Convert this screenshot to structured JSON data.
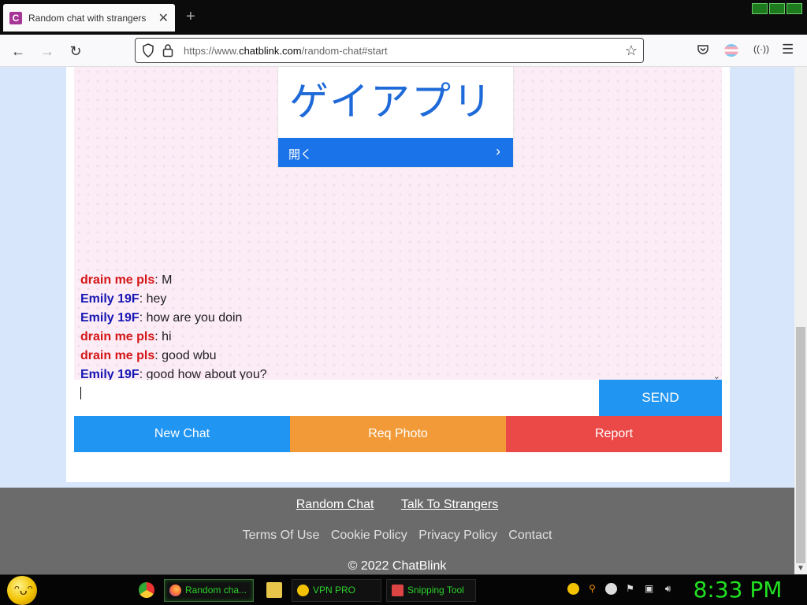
{
  "browser": {
    "tab_title": "Random chat with strangers",
    "favicon_letter": "C",
    "url_prefix": "https://www.",
    "url_host": "chatblink.com",
    "url_path": "/random-chat#start"
  },
  "ad": {
    "title": "ゲイアプリ",
    "open_label": "開く"
  },
  "chat": {
    "messages": [
      {
        "sender": "drain me pls",
        "text": ": M",
        "color": "#d41616"
      },
      {
        "sender": "Emily 19F",
        "text": ": hey",
        "color": "#1717b3"
      },
      {
        "sender": "Emily 19F",
        "text": ": how are you doin",
        "color": "#1717b3"
      },
      {
        "sender": "drain me pls",
        "text": ": hi",
        "color": "#d41616"
      },
      {
        "sender": "drain me pls",
        "text": ": good wbu",
        "color": "#d41616"
      },
      {
        "sender": "Emily 19F",
        "text": ": good how about you?",
        "color": "#1717b3"
      }
    ],
    "input_value": "",
    "send_label": "SEND"
  },
  "actions": {
    "new_chat": "New Chat",
    "req_photo": "Req Photo",
    "report": "Report"
  },
  "footer": {
    "random_chat": "Random Chat",
    "talk_to_strangers": "Talk To Strangers",
    "terms": "Terms Of Use",
    "cookie": "Cookie Policy",
    "privacy": "Privacy Policy",
    "contact": "Contact",
    "copyright": "© 2022 ChatBlink"
  },
  "taskbar": {
    "firefox_task": "Random cha...",
    "vpn_task": "VPN PRO",
    "snip_task": "Snipping Tool",
    "clock": "8:33 PM"
  },
  "colors": {
    "send": "#2095f2",
    "new_chat": "#2095f2",
    "req_photo": "#f29a38",
    "report": "#eb4848",
    "footer": "#6b6b6b",
    "clock": "#22e022"
  }
}
